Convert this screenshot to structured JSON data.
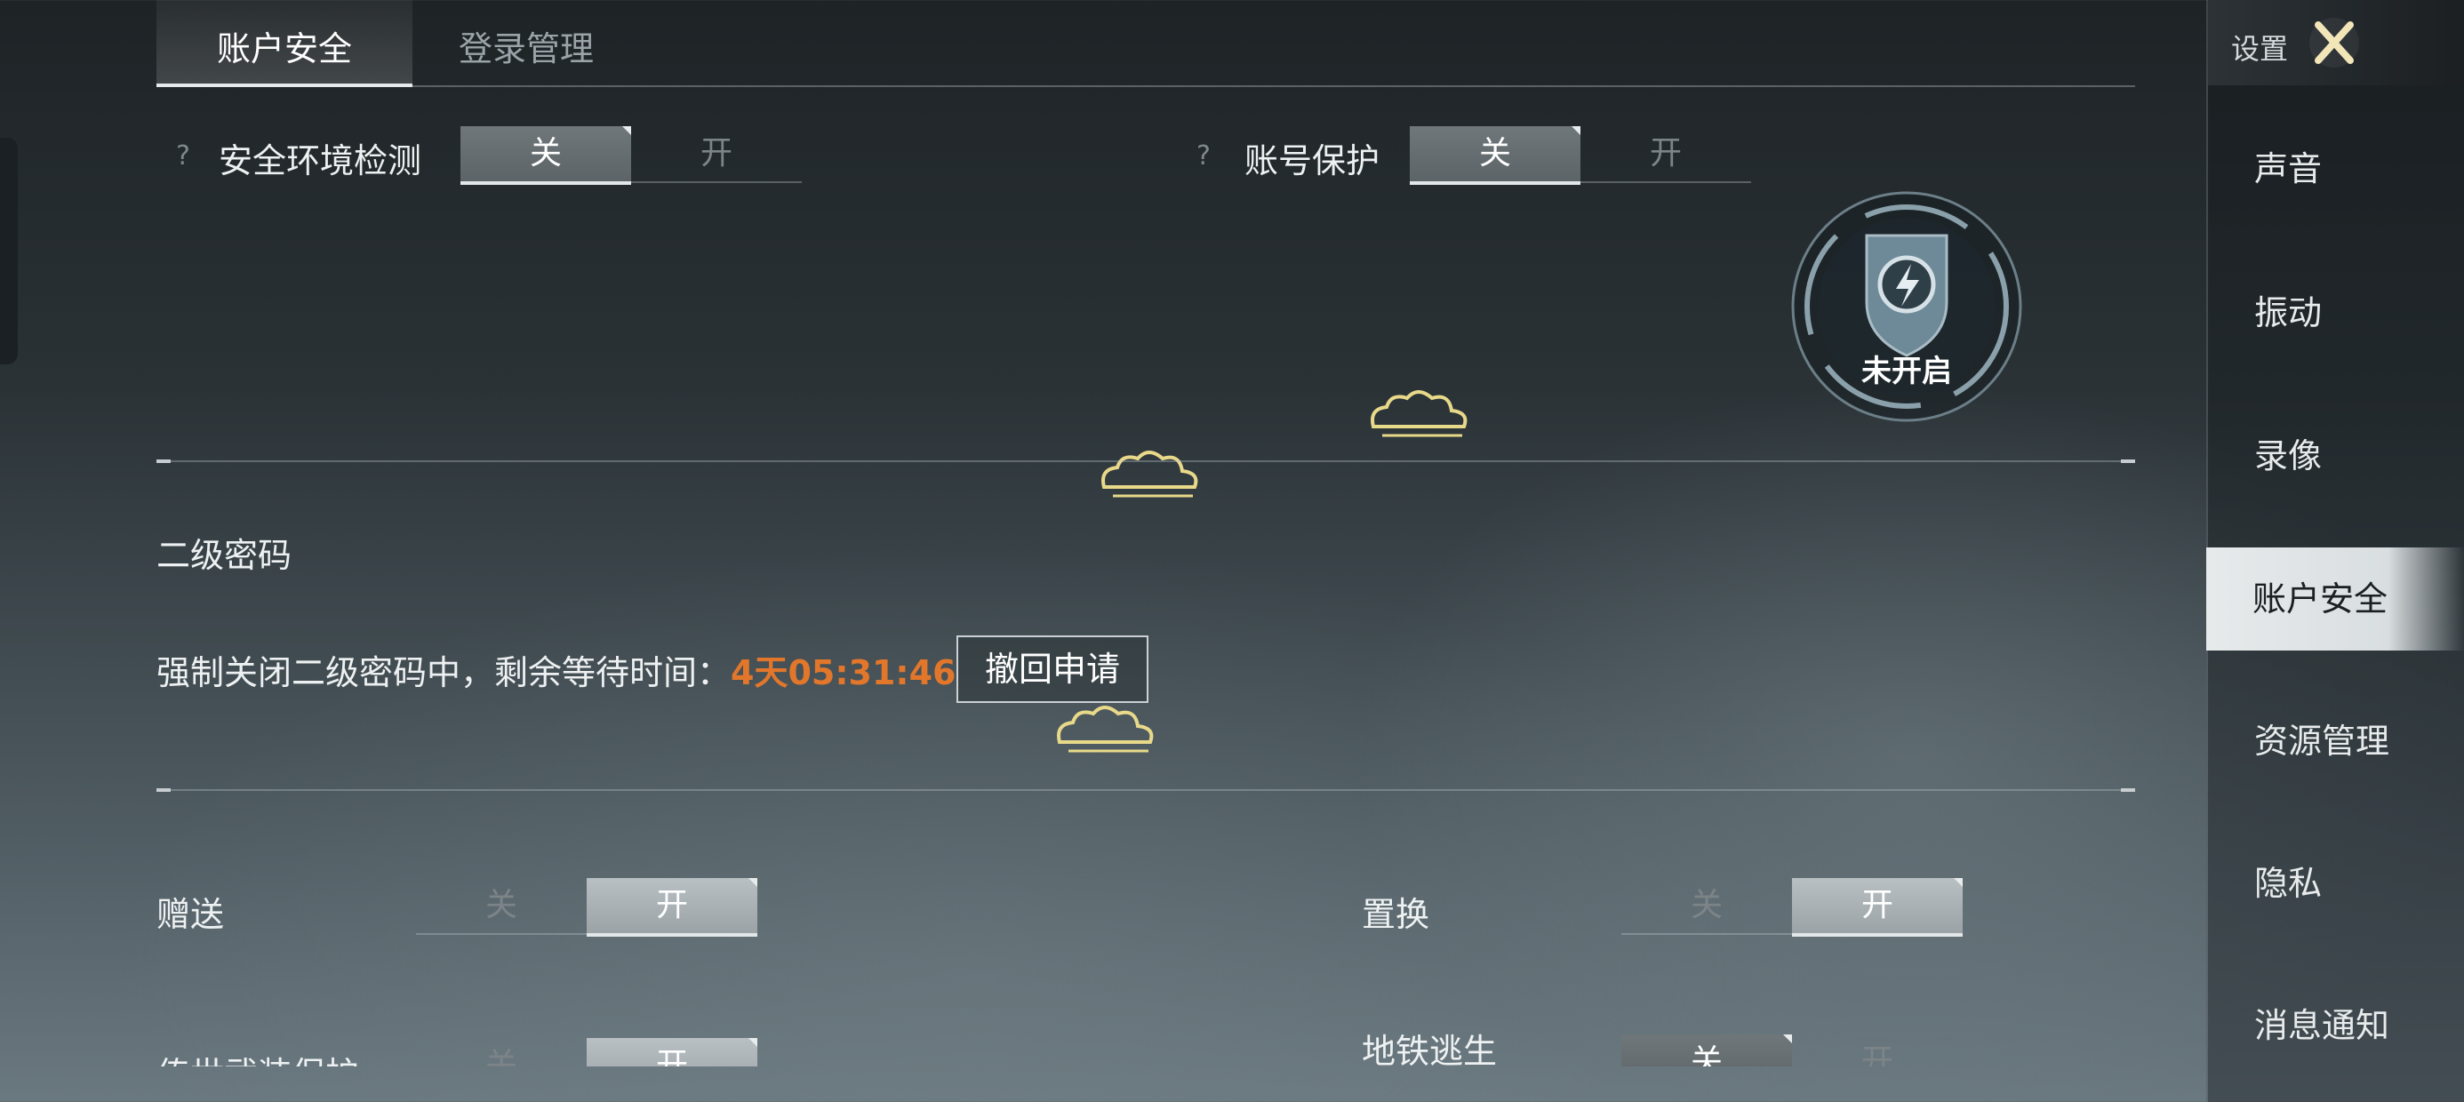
{
  "tabs": [
    {
      "label": "账户安全",
      "active": true
    },
    {
      "label": "登录管理",
      "active": false
    }
  ],
  "security_env": {
    "label": "安全环境检测",
    "off_label": "关",
    "on_label": "开",
    "state": "off"
  },
  "account_protect": {
    "label": "账号保护",
    "off_label": "关",
    "on_label": "开",
    "state": "off"
  },
  "shield": {
    "status": "未开启",
    "icon": "shield-lightning-icon"
  },
  "second_password": {
    "title": "二级密码",
    "notice": "强制关闭二级密码中，剩余等待时间：",
    "countdown": "4天05:31:46",
    "revoke_label": "撤回申请"
  },
  "gift": {
    "label": "赠送",
    "off_label": "关",
    "on_label": "开",
    "state": "on"
  },
  "exchange": {
    "label": "置换",
    "off_label": "关",
    "on_label": "开",
    "state": "on"
  },
  "legend_protect": {
    "label": "传世武装保护",
    "off_label": "关",
    "on_label": "开",
    "state": "on"
  },
  "metro": {
    "label": "地铁逃生",
    "off_label": "关",
    "on_label": "开",
    "state": "off"
  },
  "sidebar": {
    "title": "设置",
    "items": [
      {
        "label": "声音",
        "active": false
      },
      {
        "label": "振动",
        "active": false
      },
      {
        "label": "录像",
        "active": false
      },
      {
        "label": "账户安全",
        "active": true
      },
      {
        "label": "资源管理",
        "active": false
      },
      {
        "label": "隐私",
        "active": false
      },
      {
        "label": "消息通知",
        "active": false
      }
    ]
  },
  "colors": {
    "countdown": "#e2772b",
    "cloud": "#e8d98a"
  }
}
